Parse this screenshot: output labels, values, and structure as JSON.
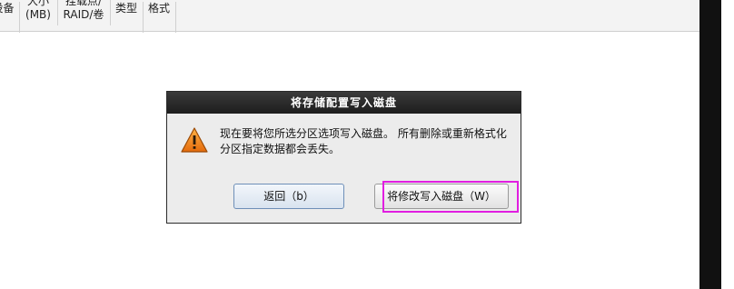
{
  "table_header": {
    "col_device": "设备",
    "col_size_line1": "大小",
    "col_size_line2": "(MB)",
    "col_mount_line1": "挂载点/",
    "col_mount_line2": "RAID/卷",
    "col_type": "类型",
    "col_format": "格式"
  },
  "dialog": {
    "title": "将存储配置写入磁盘",
    "message": "现在要将您所选分区选项写入磁盘。 所有删除或重新格式化分区指定数据都会丢失。",
    "back_button": "返回（b）",
    "write_button": "将修改写入磁盘（W）",
    "icon": "warning-icon"
  },
  "colors": {
    "title_bar": "#1d1d1d",
    "highlight": "#e11ee1",
    "warning_orange": "#f08a17"
  }
}
